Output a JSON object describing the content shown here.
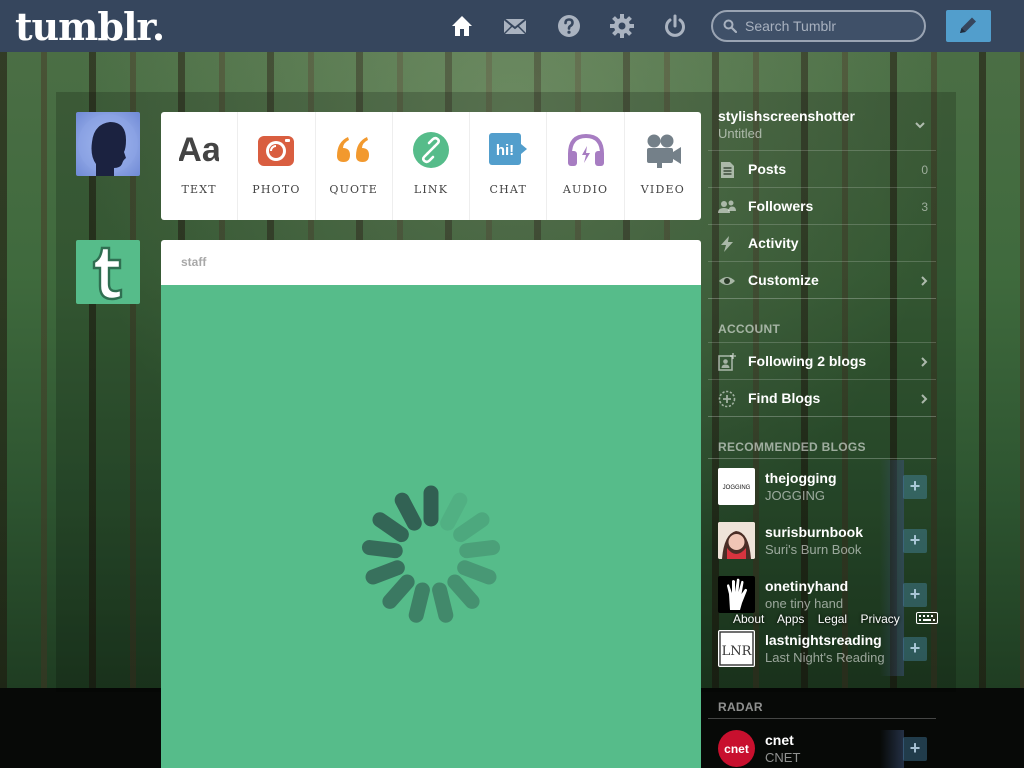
{
  "header": {
    "logo": "tumblr.",
    "search_placeholder": "Search Tumblr",
    "nav": [
      "home-icon",
      "inbox-icon",
      "help-icon",
      "settings-icon",
      "logout-icon"
    ],
    "compose_icon": "pencil-icon",
    "background_color": "#36465d",
    "compose_color": "#529ecc"
  },
  "post_types": [
    {
      "label": "TEXT",
      "icon": "text-icon",
      "color": "#444444"
    },
    {
      "label": "PHOTO",
      "icon": "camera-icon",
      "color": "#d95e40"
    },
    {
      "label": "QUOTE",
      "icon": "quote-icon",
      "color": "#f2992e"
    },
    {
      "label": "LINK",
      "icon": "link-icon",
      "color": "#56bc8a"
    },
    {
      "label": "CHAT",
      "icon": "chat-icon",
      "color": "#529ecc"
    },
    {
      "label": "AUDIO",
      "icon": "headphones-icon",
      "color": "#a77dc2"
    },
    {
      "label": "VIDEO",
      "icon": "video-camera-icon",
      "color": "#748089"
    }
  ],
  "dashboard_post": {
    "author": "staff",
    "body_color": "#56bc8a",
    "state": "loading"
  },
  "sidebar": {
    "blog_name": "stylishscreenshotter",
    "blog_title": "Untitled",
    "menu": [
      {
        "label": "Posts",
        "count": "0",
        "icon": "posts-icon"
      },
      {
        "label": "Followers",
        "count": "3",
        "icon": "followers-icon"
      },
      {
        "label": "Activity",
        "count": "",
        "icon": "activity-icon"
      },
      {
        "label": "Customize",
        "count": "",
        "icon": "eye-icon"
      }
    ],
    "account_heading": "ACCOUNT",
    "account": [
      {
        "label": "Following 2 blogs",
        "icon": "following-icon"
      },
      {
        "label": "Find Blogs",
        "icon": "find-blogs-icon"
      }
    ],
    "recommended_heading": "RECOMMENDED BLOGS",
    "recommended": [
      {
        "name": "thejogging",
        "title": "JOGGING",
        "avatar_text": "JOGGING"
      },
      {
        "name": "surisburnbook",
        "title": "Suri's Burn Book"
      },
      {
        "name": "onetinyhand",
        "title": "one tiny hand"
      },
      {
        "name": "lastnightsreading",
        "title": "Last Night's Reading",
        "avatar_text": "LNR"
      }
    ],
    "footer_links": [
      "About",
      "Apps",
      "Legal",
      "Privacy"
    ],
    "radar_heading": "RADAR",
    "radar": {
      "name": "cnet",
      "title": "CNET",
      "avatar_text": "cnet"
    },
    "follow_glyph": "+"
  }
}
